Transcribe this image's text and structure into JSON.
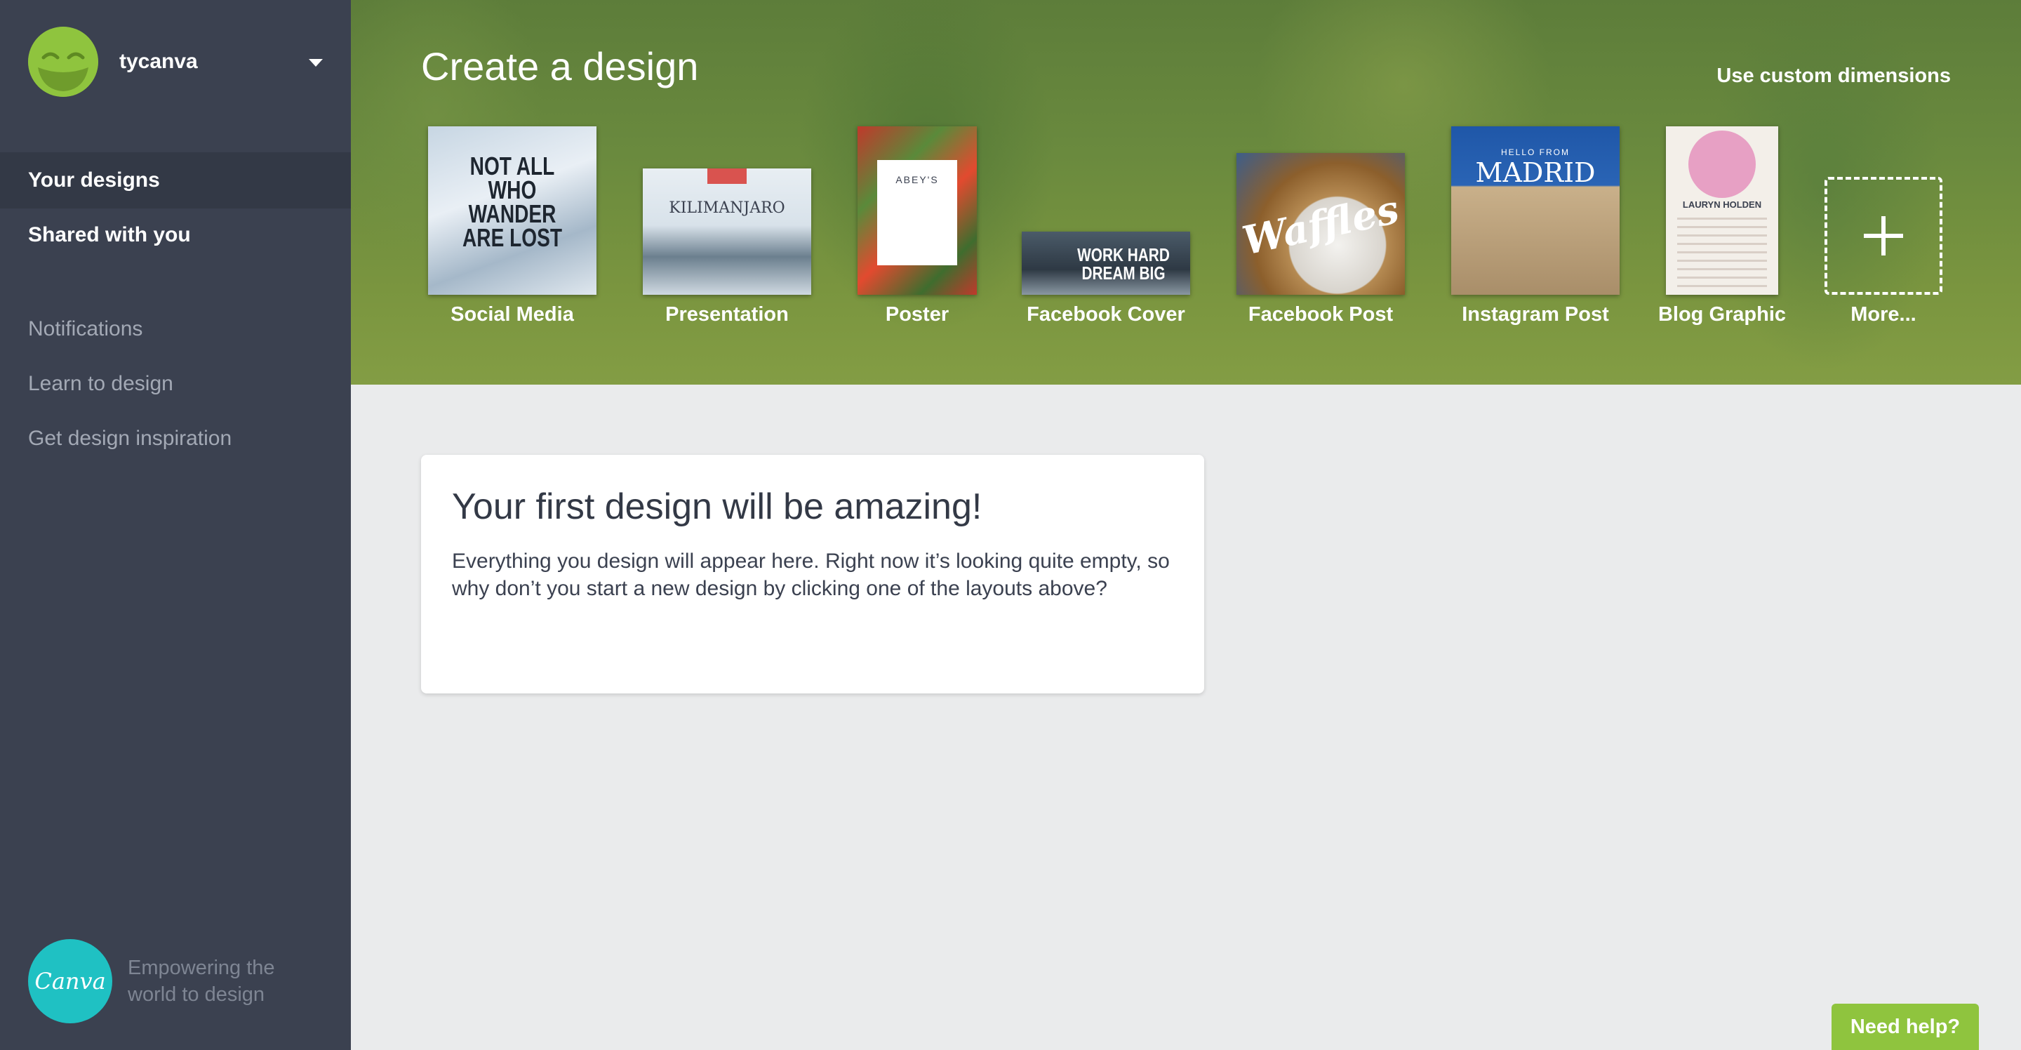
{
  "user": {
    "name": "tycanva"
  },
  "sidebar": {
    "primary": [
      {
        "label": "Your designs"
      },
      {
        "label": "Shared with you"
      }
    ],
    "secondary": [
      {
        "label": "Notifications"
      },
      {
        "label": "Learn to design"
      },
      {
        "label": "Get design inspiration"
      }
    ],
    "brand": {
      "logo_text": "Canva",
      "tagline": "Empowering the world to design"
    }
  },
  "header": {
    "title": "Create a design",
    "custom_dimensions": "Use custom dimensions"
  },
  "layouts": [
    {
      "label": "Social Media",
      "thumb_text": "NOT ALL WHO WANDER ARE LOST"
    },
    {
      "label": "Presentation",
      "thumb_text": "KILIMANJARO"
    },
    {
      "label": "Poster",
      "thumb_text": "ABEY'S"
    },
    {
      "label": "Facebook Cover",
      "thumb_text": "WORK HARD DREAM BIG"
    },
    {
      "label": "Facebook Post",
      "thumb_text": "Waffles"
    },
    {
      "label": "Instagram Post",
      "thumb_text": "MADRID",
      "thumb_subtext": "HELLO FROM"
    },
    {
      "label": "Blog Graphic",
      "thumb_text": "LAURYN HOLDEN"
    },
    {
      "label": "More..."
    }
  ],
  "empty_state": {
    "title": "Your first design will be amazing!",
    "body": "Everything you design will appear here. Right now it’s looking quite empty, so why don’t you start a new design by clicking one of the layouts above?"
  },
  "help": {
    "label": "Need help?"
  },
  "colors": {
    "sidebar_bg": "#3b4150",
    "accent_green": "#8fc43e",
    "canva_teal": "#1fc1c3"
  }
}
